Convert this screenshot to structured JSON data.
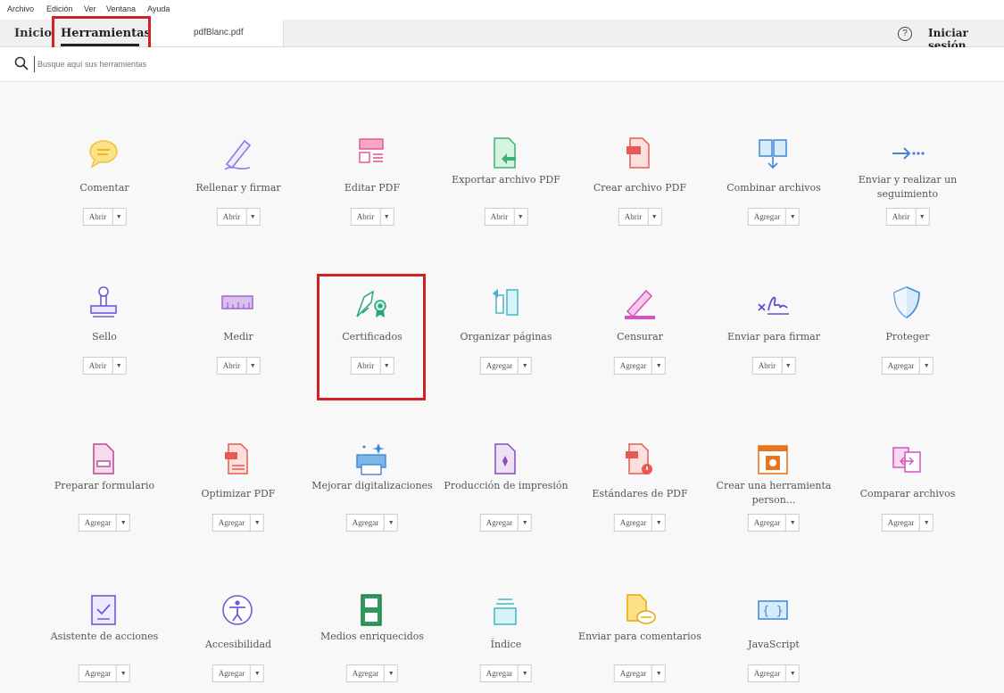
{
  "menu": [
    "Archivo",
    "Edición",
    "Ver",
    "Ventana",
    "Ayuda"
  ],
  "tabs": {
    "home": "Inicio",
    "tools": "Herramientas",
    "document": "pdfBlanc.pdf"
  },
  "signin": "Iniciar sesión",
  "help_icon": "help-icon",
  "search": {
    "placeholder": "Busque aquí sus herramientas"
  },
  "arrow": "▼",
  "tools": [
    {
      "label": "Comentar",
      "button": "Abrir",
      "icon": "comment-icon"
    },
    {
      "label": "Rellenar y firmar",
      "button": "Abrir",
      "icon": "fill-sign-icon"
    },
    {
      "label": "Editar PDF",
      "button": "Abrir",
      "icon": "edit-pdf-icon"
    },
    {
      "label": "Exportar archivo PDF",
      "button": "Abrir",
      "icon": "export-pdf-icon"
    },
    {
      "label": "Crear archivo PDF",
      "button": "Abrir",
      "icon": "create-pdf-icon"
    },
    {
      "label": "Combinar archivos",
      "button": "Agregar",
      "icon": "combine-files-icon"
    },
    {
      "label": "Enviar y realizar un seguimiento",
      "button": "Abrir",
      "icon": "send-track-icon"
    },
    {
      "label": "Sello",
      "button": "Abrir",
      "icon": "stamp-icon"
    },
    {
      "label": "Medir",
      "button": "Abrir",
      "icon": "ruler-icon"
    },
    {
      "label": "Certificados",
      "button": "Abrir",
      "icon": "certificate-icon"
    },
    {
      "label": "Organizar páginas",
      "button": "Agregar",
      "icon": "organize-pages-icon"
    },
    {
      "label": "Censurar",
      "button": "Agregar",
      "icon": "redact-icon"
    },
    {
      "label": "Enviar para firmar",
      "button": "Abrir",
      "icon": "send-sign-icon"
    },
    {
      "label": "Proteger",
      "button": "Agregar",
      "icon": "shield-icon"
    },
    {
      "label": "Preparar formulario",
      "button": "Agregar",
      "icon": "prepare-form-icon"
    },
    {
      "label": "Optimizar PDF",
      "button": "Agregar",
      "icon": "optimize-pdf-icon"
    },
    {
      "label": "Mejorar digitalizaciones",
      "button": "Agregar",
      "icon": "enhance-scan-icon"
    },
    {
      "label": "Producción de impresión",
      "button": "Agregar",
      "icon": "print-production-icon"
    },
    {
      "label": "Estándares de PDF",
      "button": "Agregar",
      "icon": "pdf-standards-icon"
    },
    {
      "label": "Crear una herramienta person...",
      "button": "Agregar",
      "icon": "custom-tool-icon"
    },
    {
      "label": "Comparar archivos",
      "button": "Agregar",
      "icon": "compare-files-icon"
    },
    {
      "label": "Asistente de acciones",
      "button": "Agregar",
      "icon": "action-wizard-icon"
    },
    {
      "label": "Accesibilidad",
      "button": "Agregar",
      "icon": "accessibility-icon"
    },
    {
      "label": "Medios enriquecidos",
      "button": "Agregar",
      "icon": "rich-media-icon"
    },
    {
      "label": "Índice",
      "button": "Agregar",
      "icon": "index-icon"
    },
    {
      "label": "Enviar para comentarios",
      "button": "Agregar",
      "icon": "send-comments-icon"
    },
    {
      "label": "JavaScript",
      "button": "Agregar",
      "icon": "javascript-icon"
    }
  ]
}
